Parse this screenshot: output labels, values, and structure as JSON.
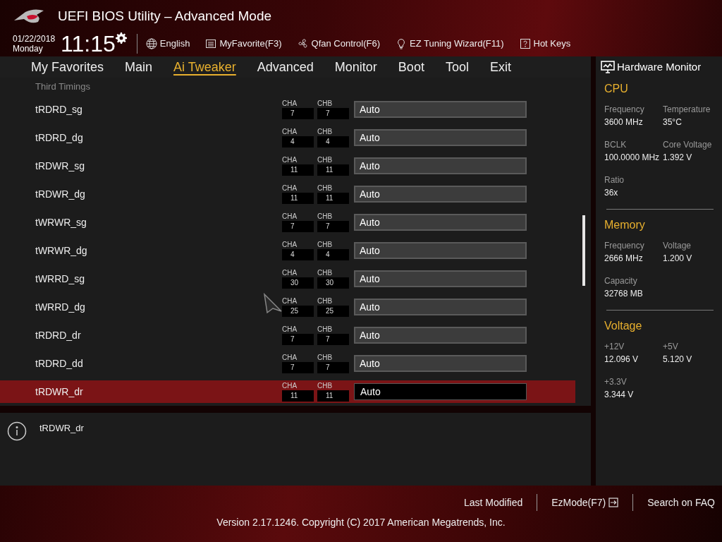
{
  "window": {
    "title": "UEFI BIOS Utility – Advanced Mode"
  },
  "header": {
    "date": "01/22/2018",
    "day": "Monday",
    "time": "11:15",
    "tools": [
      {
        "kind": "language",
        "label": "English"
      },
      {
        "kind": "favorite",
        "label": "MyFavorite(F3)"
      },
      {
        "kind": "fan",
        "label": "Qfan Control(F6)"
      },
      {
        "kind": "wizard",
        "label": "EZ Tuning Wizard(F11)"
      },
      {
        "kind": "hotkeys",
        "label": "Hot Keys"
      }
    ]
  },
  "tabs": [
    {
      "label": "My Favorites",
      "selected": false
    },
    {
      "label": "Main",
      "selected": false
    },
    {
      "label": "Ai Tweaker",
      "selected": true
    },
    {
      "label": "Advanced",
      "selected": false
    },
    {
      "label": "Monitor",
      "selected": false
    },
    {
      "label": "Boot",
      "selected": false
    },
    {
      "label": "Tool",
      "selected": false
    },
    {
      "label": "Exit",
      "selected": false
    }
  ],
  "section": "Third Timings",
  "settings": [
    {
      "name": "tRDRD_sg",
      "channels": [
        {
          "label": "CHA",
          "value": "7"
        },
        {
          "label": "CHB",
          "value": "7"
        }
      ],
      "value": "Auto",
      "selected": false
    },
    {
      "name": "tRDRD_dg",
      "channels": [
        {
          "label": "CHA",
          "value": "4"
        },
        {
          "label": "CHB",
          "value": "4"
        }
      ],
      "value": "Auto",
      "selected": false
    },
    {
      "name": "tRDWR_sg",
      "channels": [
        {
          "label": "CHA",
          "value": "11"
        },
        {
          "label": "CHB",
          "value": "11"
        }
      ],
      "value": "Auto",
      "selected": false
    },
    {
      "name": "tRDWR_dg",
      "channels": [
        {
          "label": "CHA",
          "value": "11"
        },
        {
          "label": "CHB",
          "value": "11"
        }
      ],
      "value": "Auto",
      "selected": false
    },
    {
      "name": "tWRWR_sg",
      "channels": [
        {
          "label": "CHA",
          "value": "7"
        },
        {
          "label": "CHB",
          "value": "7"
        }
      ],
      "value": "Auto",
      "selected": false
    },
    {
      "name": "tWRWR_dg",
      "channels": [
        {
          "label": "CHA",
          "value": "4"
        },
        {
          "label": "CHB",
          "value": "4"
        }
      ],
      "value": "Auto",
      "selected": false
    },
    {
      "name": "tWRRD_sg",
      "channels": [
        {
          "label": "CHA",
          "value": "30"
        },
        {
          "label": "CHB",
          "value": "30"
        }
      ],
      "value": "Auto",
      "selected": false
    },
    {
      "name": "tWRRD_dg",
      "channels": [
        {
          "label": "CHA",
          "value": "25"
        },
        {
          "label": "CHB",
          "value": "25"
        }
      ],
      "value": "Auto",
      "selected": false
    },
    {
      "name": "tRDRD_dr",
      "channels": [
        {
          "label": "CHA",
          "value": "7"
        },
        {
          "label": "CHB",
          "value": "7"
        }
      ],
      "value": "Auto",
      "selected": false
    },
    {
      "name": "tRDRD_dd",
      "channels": [
        {
          "label": "CHA",
          "value": "7"
        },
        {
          "label": "CHB",
          "value": "7"
        }
      ],
      "value": "Auto",
      "selected": false
    },
    {
      "name": "tRDWR_dr",
      "channels": [
        {
          "label": "CHA",
          "value": "11"
        },
        {
          "label": "CHB",
          "value": "11"
        }
      ],
      "value": "Auto",
      "selected": true
    }
  ],
  "help": {
    "text": "tRDWR_dr"
  },
  "hardware_monitor": {
    "title": "Hardware Monitor",
    "groups": [
      {
        "title": "CPU",
        "items": [
          {
            "label": "Frequency",
            "value": "3600 MHz"
          },
          {
            "label": "Temperature",
            "value": "35°C"
          },
          {
            "label": "BCLK",
            "value": "100.0000 MHz"
          },
          {
            "label": "Core Voltage",
            "value": "1.392 V"
          },
          {
            "label": "Ratio",
            "value": "36x"
          }
        ]
      },
      {
        "title": "Memory",
        "items": [
          {
            "label": "Frequency",
            "value": "2666 MHz"
          },
          {
            "label": "Voltage",
            "value": "1.200 V"
          },
          {
            "label": "Capacity",
            "value": "32768 MB"
          }
        ]
      },
      {
        "title": "Voltage",
        "items": [
          {
            "label": "+12V",
            "value": "12.096 V"
          },
          {
            "label": "+5V",
            "value": "5.120 V"
          },
          {
            "label": "+3.3V",
            "value": "3.344 V"
          }
        ]
      }
    ]
  },
  "footer": {
    "links": [
      {
        "kind": "text",
        "label": "Last Modified"
      },
      {
        "kind": "ezmode",
        "label": "EzMode(F7)"
      },
      {
        "kind": "text",
        "label": "Search on FAQ"
      }
    ],
    "version": "Version 2.17.1246. Copyright (C) 2017 American Megatrends, Inc."
  }
}
